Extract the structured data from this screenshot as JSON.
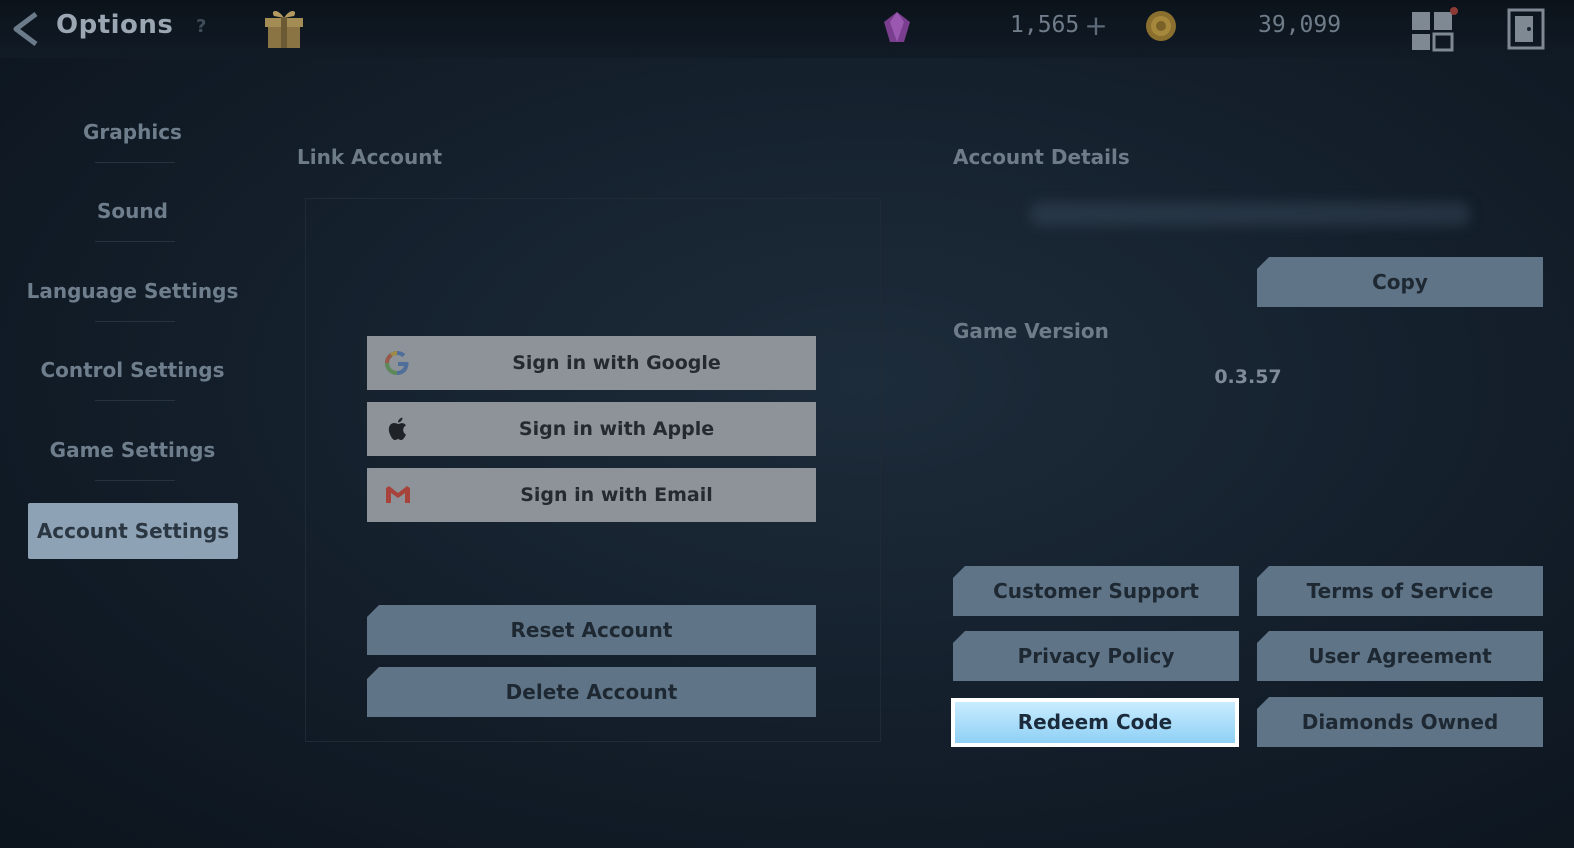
{
  "header": {
    "title": "Options",
    "help_label": "?",
    "gems": "1,565",
    "plus_label": "+",
    "coins": "39,099"
  },
  "sidebar": {
    "items": [
      {
        "label": "Graphics"
      },
      {
        "label": "Sound"
      },
      {
        "label": "Language Settings"
      },
      {
        "label": "Control Settings"
      },
      {
        "label": "Game Settings"
      },
      {
        "label": "Account Settings"
      }
    ],
    "active_index": 5
  },
  "link_account": {
    "title": "Link Account",
    "google_label": "Sign in with Google",
    "apple_label": "Sign in with Apple",
    "email_label": "Sign in with Email",
    "reset_label": "Reset Account",
    "delete_label": "Delete Account"
  },
  "account_details": {
    "title": "Account Details",
    "copy_label": "Copy",
    "version_title": "Game Version",
    "version_value": "0.3.57",
    "customer_support_label": "Customer Support",
    "terms_label": "Terms of Service",
    "privacy_label": "Privacy Policy",
    "user_agreement_label": "User Agreement",
    "redeem_label": "Redeem Code",
    "diamonds_label": "Diamonds Owned"
  },
  "colors": {
    "background": "#131e2a",
    "button": "#5f7587",
    "signin_button": "#8d9398",
    "active_tab": "#8da2b4",
    "highlight": "#8fd0f5"
  }
}
